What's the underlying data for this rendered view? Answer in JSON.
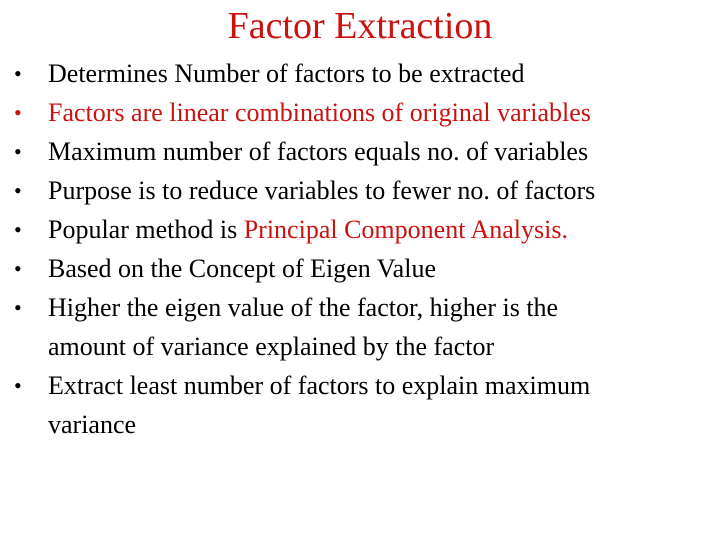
{
  "slide": {
    "title": "Factor Extraction",
    "accent_color": "#cc1111",
    "bullets": [
      {
        "text": "Determines Number of factors to be extracted"
      },
      {
        "text": "Factors are linear combinations of original variables",
        "color": "red"
      },
      {
        "text": "Maximum number of factors equals no. of variables"
      },
      {
        "text": "Purpose is to reduce variables to fewer no. of factors"
      },
      {
        "prefix": "Popular method is ",
        "highlight": "Principal Component Analysis."
      },
      {
        "text": "Based on the Concept of Eigen Value"
      },
      {
        "line1": "Higher the eigen value of the factor, higher is the",
        "line2": "amount of variance explained by the factor"
      },
      {
        "line1": "Extract least number of factors to explain maximum",
        "line2": "variance"
      }
    ]
  }
}
